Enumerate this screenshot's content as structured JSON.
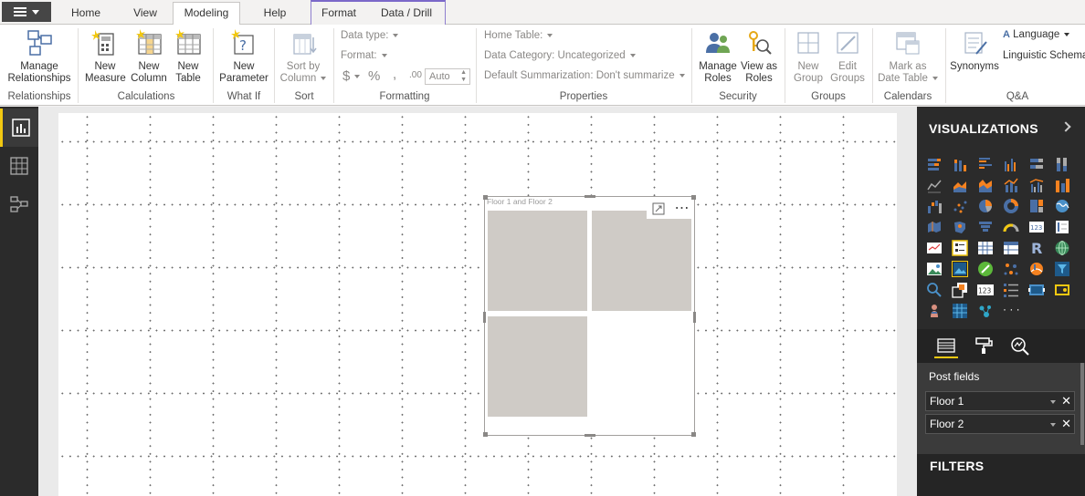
{
  "tabs": {
    "home": "Home",
    "view": "View",
    "modeling": "Modeling",
    "help": "Help",
    "format": "Format",
    "data_drill": "Data / Drill"
  },
  "ribbon": {
    "manage_relationships": [
      "Manage",
      "Relationships"
    ],
    "new_measure": [
      "New",
      "Measure"
    ],
    "new_column": [
      "New",
      "Column"
    ],
    "new_table": [
      "New",
      "Table"
    ],
    "new_parameter": [
      "New",
      "Parameter"
    ],
    "sort_by_column": [
      "Sort by",
      "Column"
    ],
    "data_type": "Data type:",
    "format": "Format:",
    "currency": "$",
    "percent": "%",
    "comma": ",",
    "decimals": ".00",
    "auto": "Auto",
    "home_table": "Home Table:",
    "data_category": "Data Category: Uncategorized",
    "default_summarization": "Default Summarization: Don't summarize",
    "manage_roles": [
      "Manage",
      "Roles"
    ],
    "view_as_roles": [
      "View as",
      "Roles"
    ],
    "new_group": [
      "New",
      "Group"
    ],
    "edit_groups": [
      "Edit",
      "Groups"
    ],
    "mark_as_date_table": [
      "Mark as",
      "Date Table"
    ],
    "synonyms": "Synonyms",
    "language": "Language",
    "linguistic_schema": "Linguistic Schema",
    "groups": {
      "relationships": "Relationships",
      "calculations": "Calculations",
      "what_if": "What If",
      "sort": "Sort",
      "formatting": "Formatting",
      "properties": "Properties",
      "security": "Security",
      "groups": "Groups",
      "calendars": "Calendars",
      "qa": "Q&A"
    }
  },
  "visual": {
    "title": "Floor 1  and Floor 2",
    "more": "⋯"
  },
  "panel": {
    "visualizations": "VISUALIZATIONS",
    "post_fields": "Post fields",
    "fields": [
      "Floor 1",
      "Floor 2"
    ],
    "filters": "FILTERS",
    "ellipsis": "· · ·",
    "r_icon": "R",
    "number_card": "123"
  },
  "colors": {
    "accent_yellow": "#f2c811",
    "dark_panel": "#2b2b2b",
    "tile_gray": "#cfcbc6",
    "ribbon_blue": "#4a6fa5"
  }
}
